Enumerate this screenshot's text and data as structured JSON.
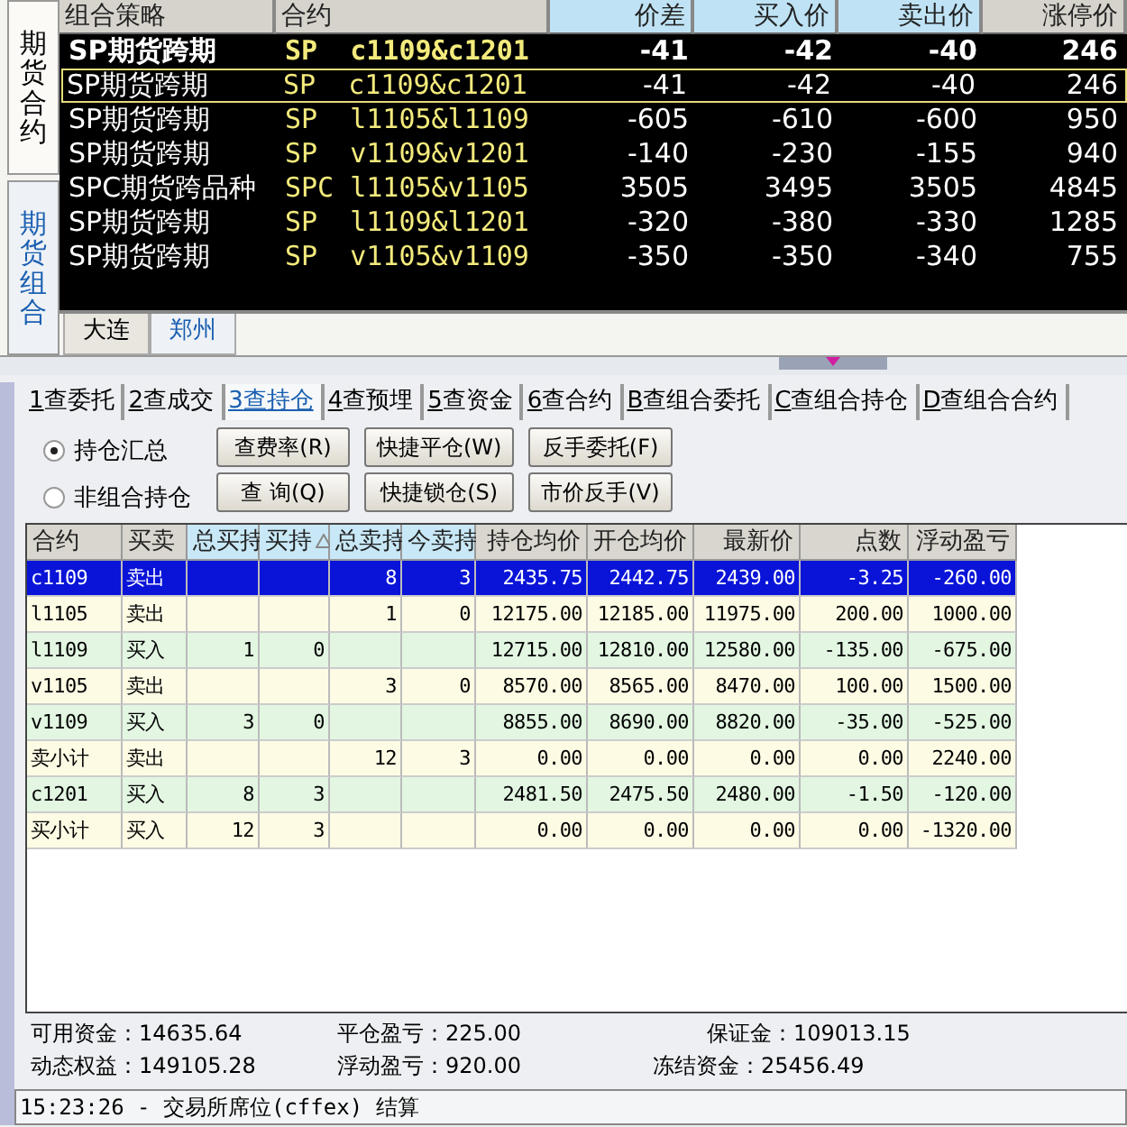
{
  "side_tabs": [
    {
      "label": "期货合约",
      "selected": false
    },
    {
      "label": "期货组合",
      "selected": true
    }
  ],
  "combo_table": {
    "columns": [
      {
        "label": "组合策略",
        "highlighted": false
      },
      {
        "label": "合约",
        "highlighted": false
      },
      {
        "label": "价差",
        "highlighted": true
      },
      {
        "label": "买入价",
        "highlighted": true
      },
      {
        "label": "卖出价",
        "highlighted": true
      },
      {
        "label": "涨停价",
        "highlighted": false
      }
    ],
    "rows": [
      {
        "bold": true,
        "selected": false,
        "cells": [
          "SP期货跨期",
          "SP  c1109&c1201",
          "-41",
          "-42",
          "-40",
          "246"
        ]
      },
      {
        "bold": false,
        "selected": true,
        "cells": [
          "SP期货跨期",
          "SP  c1109&c1201",
          "-41",
          "-42",
          "-40",
          "246"
        ]
      },
      {
        "bold": false,
        "selected": false,
        "cells": [
          "SP期货跨期",
          "SP  l1105&l1109",
          "-605",
          "-610",
          "-600",
          "950"
        ]
      },
      {
        "bold": false,
        "selected": false,
        "cells": [
          "SP期货跨期",
          "SP  v1109&v1201",
          "-140",
          "-230",
          "-155",
          "940"
        ]
      },
      {
        "bold": false,
        "selected": false,
        "cells": [
          "SPC期货跨品种",
          "SPC l1105&v1105",
          "3505",
          "3495",
          "3505",
          "4845"
        ]
      },
      {
        "bold": false,
        "selected": false,
        "cells": [
          "SP期货跨期",
          "SP  l1109&l1201",
          "-320",
          "-380",
          "-330",
          "1285"
        ]
      },
      {
        "bold": false,
        "selected": false,
        "cells": [
          "SP期货跨期",
          "SP  v1105&v1109",
          "-350",
          "-350",
          "-340",
          "755"
        ]
      }
    ]
  },
  "exchange_tabs": [
    {
      "label": "大连",
      "selected": false
    },
    {
      "label": "郑州",
      "selected": true
    }
  ],
  "query_tabs": [
    {
      "label": "1查委托",
      "selected": false
    },
    {
      "label": "2查成交",
      "selected": false
    },
    {
      "label": "3查持仓",
      "selected": true
    },
    {
      "label": "4查预埋",
      "selected": false
    },
    {
      "label": "5查资金",
      "selected": false
    },
    {
      "label": "6查合约",
      "selected": false
    },
    {
      "label": "B查组合委托",
      "selected": false
    },
    {
      "label": "C查组合持仓",
      "selected": false
    },
    {
      "label": "D查组合合约",
      "selected": false
    }
  ],
  "view_options": [
    {
      "label": "持仓汇总",
      "selected": true
    },
    {
      "label": "非组合持仓",
      "selected": false
    }
  ],
  "buttons": [
    [
      "查费率(R)",
      "快捷平仓(W)",
      "反手委托(F)"
    ],
    [
      "查 询(Q)",
      "快捷锁仓(S)",
      "市价反手(V)"
    ]
  ],
  "position_table": {
    "columns": [
      {
        "label": "合约",
        "highlighted": false
      },
      {
        "label": "买卖",
        "highlighted": false
      },
      {
        "label": "总买持",
        "highlighted": true
      },
      {
        "label": "买持",
        "highlighted": true,
        "sorted": true
      },
      {
        "label": "总卖持",
        "highlighted": true
      },
      {
        "label": "今卖持",
        "highlighted": true
      },
      {
        "label": "持仓均价",
        "highlighted": false
      },
      {
        "label": "开仓均价",
        "highlighted": false
      },
      {
        "label": "最新价",
        "highlighted": false
      },
      {
        "label": "点数",
        "highlighted": false
      },
      {
        "label": "浮动盈亏",
        "highlighted": false
      }
    ],
    "rows": [
      {
        "selected": true,
        "cells": [
          "c1109",
          "卖出",
          null,
          null,
          "8",
          "3",
          "2435.75",
          "2442.75",
          "2439.00",
          "-3.25",
          "-260.00"
        ]
      },
      {
        "selected": false,
        "cells": [
          "l1105",
          "卖出",
          null,
          null,
          "1",
          "0",
          "12175.00",
          "12185.00",
          "11975.00",
          "200.00",
          "1000.00"
        ]
      },
      {
        "selected": false,
        "cells": [
          "l1109",
          "买入",
          "1",
          "0",
          null,
          null,
          "12715.00",
          "12810.00",
          "12580.00",
          "-135.00",
          "-675.00"
        ]
      },
      {
        "selected": false,
        "cells": [
          "v1105",
          "卖出",
          null,
          null,
          "3",
          "0",
          "8570.00",
          "8565.00",
          "8470.00",
          "100.00",
          "1500.00"
        ]
      },
      {
        "selected": false,
        "cells": [
          "v1109",
          "买入",
          "3",
          "0",
          null,
          null,
          "8855.00",
          "8690.00",
          "8820.00",
          "-35.00",
          "-525.00"
        ]
      },
      {
        "selected": false,
        "cells": [
          "卖小计",
          "卖出",
          null,
          null,
          "12",
          "3",
          "0.00",
          "0.00",
          "0.00",
          "0.00",
          "2240.00"
        ]
      },
      {
        "selected": false,
        "cells": [
          "c1201",
          "买入",
          "8",
          "3",
          null,
          null,
          "2481.50",
          "2475.50",
          "2480.00",
          "-1.50",
          "-120.00"
        ]
      },
      {
        "selected": false,
        "cells": [
          "买小计",
          "买入",
          "12",
          "3",
          null,
          null,
          "0.00",
          "0.00",
          "0.00",
          "0.00",
          "-1320.00"
        ]
      }
    ]
  },
  "summary": [
    [
      "可用资金：14635.64",
      "平仓盈亏：225.00",
      "保证金：109013.15"
    ],
    [
      "动态权益：149105.28",
      "浮动盈亏：920.00",
      "冻结资金：25456.49"
    ]
  ],
  "status_bar": "15:23:26 - 交易所席位(cffex) 结算"
}
